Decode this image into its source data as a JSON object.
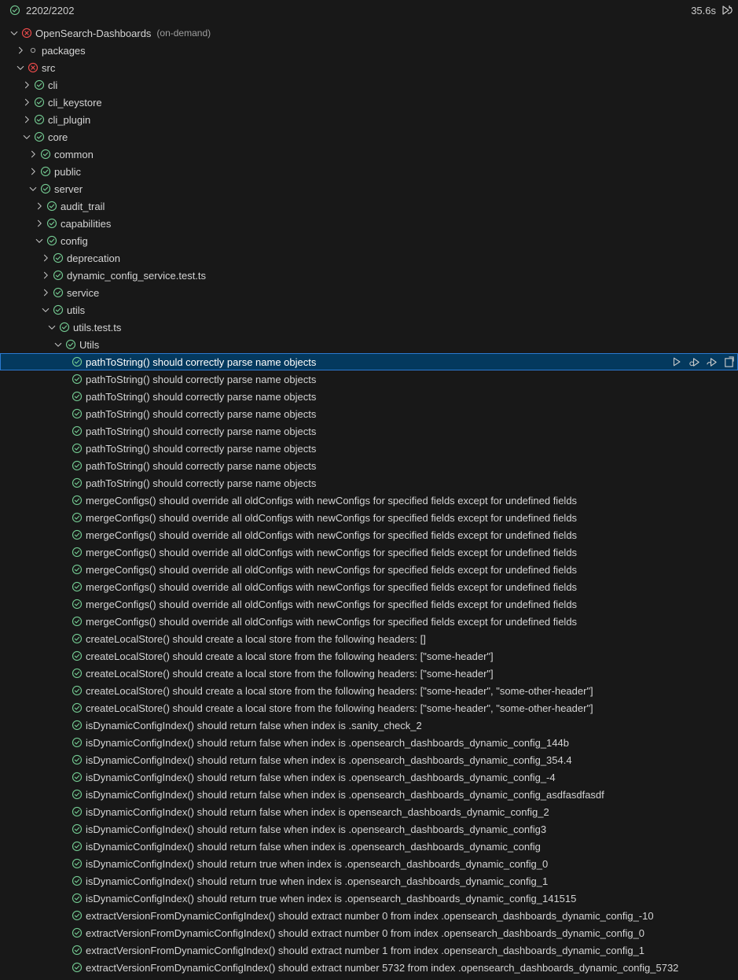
{
  "colors": {
    "pass": "#73c991",
    "fail": "#f14c4c",
    "skip": "#9d9d9d",
    "background": "#181818",
    "selection": "#04395e"
  },
  "summary": {
    "count": "2202/2202",
    "duration": "35.6s",
    "status_icon": "pass-circle-icon",
    "rerun_icon": "rerun-icon"
  },
  "row_actions": [
    "run-test-icon",
    "debug-test-icon",
    "run-with-coverage-icon",
    "go-to-test-icon"
  ],
  "tree": [
    {
      "label": "OpenSearch-Dashboards",
      "desc": "(on-demand)",
      "status": "fail",
      "depth": 0,
      "twistie": "open"
    },
    {
      "label": "packages",
      "status": "skip",
      "depth": 1,
      "twistie": "closed"
    },
    {
      "label": "src",
      "status": "fail",
      "depth": 1,
      "twistie": "open"
    },
    {
      "label": "cli",
      "status": "pass",
      "depth": 2,
      "twistie": "closed"
    },
    {
      "label": "cli_keystore",
      "status": "pass",
      "depth": 2,
      "twistie": "closed"
    },
    {
      "label": "cli_plugin",
      "status": "pass",
      "depth": 2,
      "twistie": "closed"
    },
    {
      "label": "core",
      "status": "pass",
      "depth": 2,
      "twistie": "open"
    },
    {
      "label": "common",
      "status": "pass",
      "depth": 3,
      "twistie": "closed"
    },
    {
      "label": "public",
      "status": "pass",
      "depth": 3,
      "twistie": "closed"
    },
    {
      "label": "server",
      "status": "pass",
      "depth": 3,
      "twistie": "open"
    },
    {
      "label": "audit_trail",
      "status": "pass",
      "depth": 4,
      "twistie": "closed"
    },
    {
      "label": "capabilities",
      "status": "pass",
      "depth": 4,
      "twistie": "closed"
    },
    {
      "label": "config",
      "status": "pass",
      "depth": 4,
      "twistie": "open"
    },
    {
      "label": "deprecation",
      "status": "pass",
      "depth": 5,
      "twistie": "closed"
    },
    {
      "label": "dynamic_config_service.test.ts",
      "status": "pass",
      "depth": 5,
      "twistie": "closed"
    },
    {
      "label": "service",
      "status": "pass",
      "depth": 5,
      "twistie": "closed"
    },
    {
      "label": "utils",
      "status": "pass",
      "depth": 5,
      "twistie": "open"
    },
    {
      "label": "utils.test.ts",
      "status": "pass",
      "depth": 6,
      "twistie": "open"
    },
    {
      "label": "Utils",
      "status": "pass",
      "depth": 7,
      "twistie": "open"
    },
    {
      "label": "pathToString() should correctly parse name objects",
      "status": "pass",
      "depth": 8,
      "twistie": "none",
      "selected": true
    },
    {
      "label": "pathToString() should correctly parse name objects",
      "status": "pass",
      "depth": 8,
      "twistie": "none"
    },
    {
      "label": "pathToString() should correctly parse name objects",
      "status": "pass",
      "depth": 8,
      "twistie": "none"
    },
    {
      "label": "pathToString() should correctly parse name objects",
      "status": "pass",
      "depth": 8,
      "twistie": "none"
    },
    {
      "label": "pathToString() should correctly parse name objects",
      "status": "pass",
      "depth": 8,
      "twistie": "none"
    },
    {
      "label": "pathToString() should correctly parse name objects",
      "status": "pass",
      "depth": 8,
      "twistie": "none"
    },
    {
      "label": "pathToString() should correctly parse name objects",
      "status": "pass",
      "depth": 8,
      "twistie": "none"
    },
    {
      "label": "pathToString() should correctly parse name objects",
      "status": "pass",
      "depth": 8,
      "twistie": "none"
    },
    {
      "label": "mergeConfigs() should override all oldConfigs with newConfigs for specified fields except for undefined fields",
      "status": "pass",
      "depth": 8,
      "twistie": "none"
    },
    {
      "label": "mergeConfigs() should override all oldConfigs with newConfigs for specified fields except for undefined fields",
      "status": "pass",
      "depth": 8,
      "twistie": "none"
    },
    {
      "label": "mergeConfigs() should override all oldConfigs with newConfigs for specified fields except for undefined fields",
      "status": "pass",
      "depth": 8,
      "twistie": "none"
    },
    {
      "label": "mergeConfigs() should override all oldConfigs with newConfigs for specified fields except for undefined fields",
      "status": "pass",
      "depth": 8,
      "twistie": "none"
    },
    {
      "label": "mergeConfigs() should override all oldConfigs with newConfigs for specified fields except for undefined fields",
      "status": "pass",
      "depth": 8,
      "twistie": "none"
    },
    {
      "label": "mergeConfigs() should override all oldConfigs with newConfigs for specified fields except for undefined fields",
      "status": "pass",
      "depth": 8,
      "twistie": "none"
    },
    {
      "label": "mergeConfigs() should override all oldConfigs with newConfigs for specified fields except for undefined fields",
      "status": "pass",
      "depth": 8,
      "twistie": "none"
    },
    {
      "label": "mergeConfigs() should override all oldConfigs with newConfigs for specified fields except for undefined fields",
      "status": "pass",
      "depth": 8,
      "twistie": "none"
    },
    {
      "label": "createLocalStore() should create a local store from the following headers: []",
      "status": "pass",
      "depth": 8,
      "twistie": "none"
    },
    {
      "label": "createLocalStore() should create a local store from the following headers: [\"some-header\"]",
      "status": "pass",
      "depth": 8,
      "twistie": "none"
    },
    {
      "label": "createLocalStore() should create a local store from the following headers: [\"some-header\"]",
      "status": "pass",
      "depth": 8,
      "twistie": "none"
    },
    {
      "label": "createLocalStore() should create a local store from the following headers: [\"some-header\", \"some-other-header\"]",
      "status": "pass",
      "depth": 8,
      "twistie": "none"
    },
    {
      "label": "createLocalStore() should create a local store from the following headers: [\"some-header\", \"some-other-header\"]",
      "status": "pass",
      "depth": 8,
      "twistie": "none"
    },
    {
      "label": "isDynamicConfigIndex() should return false when index is .sanity_check_2",
      "status": "pass",
      "depth": 8,
      "twistie": "none"
    },
    {
      "label": "isDynamicConfigIndex() should return false when index is .opensearch_dashboards_dynamic_config_144b",
      "status": "pass",
      "depth": 8,
      "twistie": "none"
    },
    {
      "label": "isDynamicConfigIndex() should return false when index is .opensearch_dashboards_dynamic_config_354.4",
      "status": "pass",
      "depth": 8,
      "twistie": "none"
    },
    {
      "label": "isDynamicConfigIndex() should return false when index is .opensearch_dashboards_dynamic_config_-4",
      "status": "pass",
      "depth": 8,
      "twistie": "none"
    },
    {
      "label": "isDynamicConfigIndex() should return false when index is .opensearch_dashboards_dynamic_config_asdfasdfasdf",
      "status": "pass",
      "depth": 8,
      "twistie": "none"
    },
    {
      "label": "isDynamicConfigIndex() should return false when index is opensearch_dashboards_dynamic_config_2",
      "status": "pass",
      "depth": 8,
      "twistie": "none"
    },
    {
      "label": "isDynamicConfigIndex() should return false when index is .opensearch_dashboards_dynamic_config3",
      "status": "pass",
      "depth": 8,
      "twistie": "none"
    },
    {
      "label": "isDynamicConfigIndex() should return false when index is .opensearch_dashboards_dynamic_config",
      "status": "pass",
      "depth": 8,
      "twistie": "none"
    },
    {
      "label": "isDynamicConfigIndex() should return true when index is .opensearch_dashboards_dynamic_config_0",
      "status": "pass",
      "depth": 8,
      "twistie": "none"
    },
    {
      "label": "isDynamicConfigIndex() should return true when index is .opensearch_dashboards_dynamic_config_1",
      "status": "pass",
      "depth": 8,
      "twistie": "none"
    },
    {
      "label": "isDynamicConfigIndex() should return true when index is .opensearch_dashboards_dynamic_config_141515",
      "status": "pass",
      "depth": 8,
      "twistie": "none"
    },
    {
      "label": "extractVersionFromDynamicConfigIndex() should extract number 0 from index .opensearch_dashboards_dynamic_config_-10",
      "status": "pass",
      "depth": 8,
      "twistie": "none"
    },
    {
      "label": "extractVersionFromDynamicConfigIndex() should extract number 0 from index .opensearch_dashboards_dynamic_config_0",
      "status": "pass",
      "depth": 8,
      "twistie": "none"
    },
    {
      "label": "extractVersionFromDynamicConfigIndex() should extract number 1 from index .opensearch_dashboards_dynamic_config_1",
      "status": "pass",
      "depth": 8,
      "twistie": "none"
    },
    {
      "label": "extractVersionFromDynamicConfigIndex() should extract number 5732 from index .opensearch_dashboards_dynamic_config_5732",
      "status": "pass",
      "depth": 8,
      "twistie": "none"
    }
  ]
}
